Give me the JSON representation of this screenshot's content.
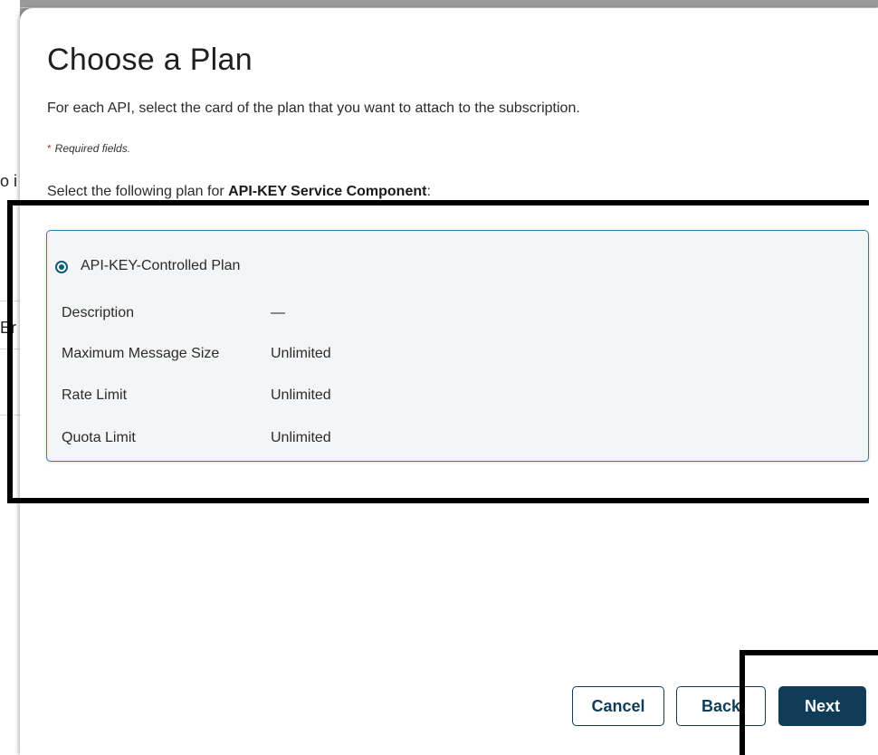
{
  "background": {
    "fragment_1": "o i",
    "fragment_2": "Er"
  },
  "modal": {
    "title": "Choose a Plan",
    "intro": "For each API, select the card of the plan that you want to attach to the subscription.",
    "required_star": "*",
    "required_text": "Required fields.",
    "select_prefix": "Select the following plan for ",
    "select_api": "API-KEY Service Component",
    "select_suffix": ":"
  },
  "plan": {
    "selected": true,
    "name": "API-KEY-Controlled Plan",
    "rows": [
      {
        "key": "Description",
        "value": "—"
      },
      {
        "key": "Maximum Message Size",
        "value": "Unlimited"
      },
      {
        "key": "Rate Limit",
        "value": "Unlimited"
      },
      {
        "key": "Quota Limit",
        "value": "Unlimited"
      }
    ]
  },
  "buttons": {
    "cancel": "Cancel",
    "back": "Back",
    "next": "Next"
  },
  "colors": {
    "primary": "#0f3d57",
    "card_border": "#2f7fa0",
    "required_star": "#c0392b"
  }
}
